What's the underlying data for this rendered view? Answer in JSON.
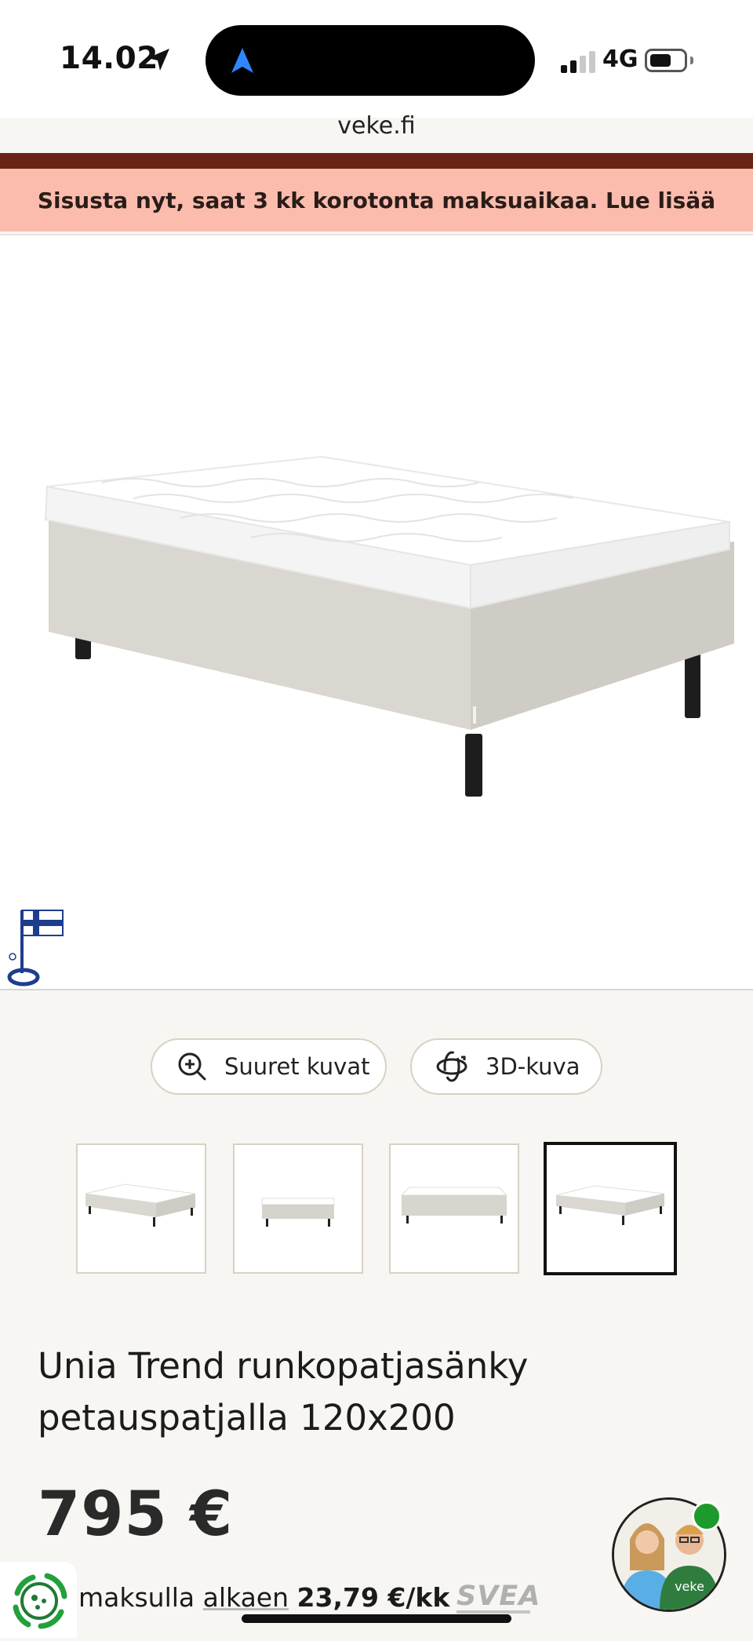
{
  "status_bar": {
    "time": "14.02",
    "network": "4G",
    "location_icon": "location-arrow-icon",
    "island_icon": "nav-arrow-icon",
    "signal_icon": "signal-bars-icon",
    "battery_icon": "battery-icon"
  },
  "browser": {
    "url": "veke.fi"
  },
  "promo_banner": {
    "text": "Sisusta nyt, saat 3 kk korotonta maksuaikaa. Lue lisää",
    "bg_color": "#fbbcad",
    "strip_color": "#6a2416"
  },
  "gallery": {
    "zoom_label": "Suuret kuvat",
    "zoom_icon": "zoom-in-icon",
    "view3d_label": "3D-kuva",
    "view3d_icon": "rotate-3d-icon",
    "selected_thumbnail": 4
  },
  "product": {
    "title_line1": "Unia Trend runkopatjasänky",
    "title_line2": "petauspatjalla 120x200",
    "price": "795 €"
  },
  "financing": {
    "text_prefix": "maksulla",
    "text_link": "alkaen",
    "amount": "23,79 €/kk",
    "provider": "SVEA",
    "icon": "recycle-circle-icon"
  },
  "chat": {
    "brand_text": "veke",
    "online_color": "#1c9a2b"
  }
}
